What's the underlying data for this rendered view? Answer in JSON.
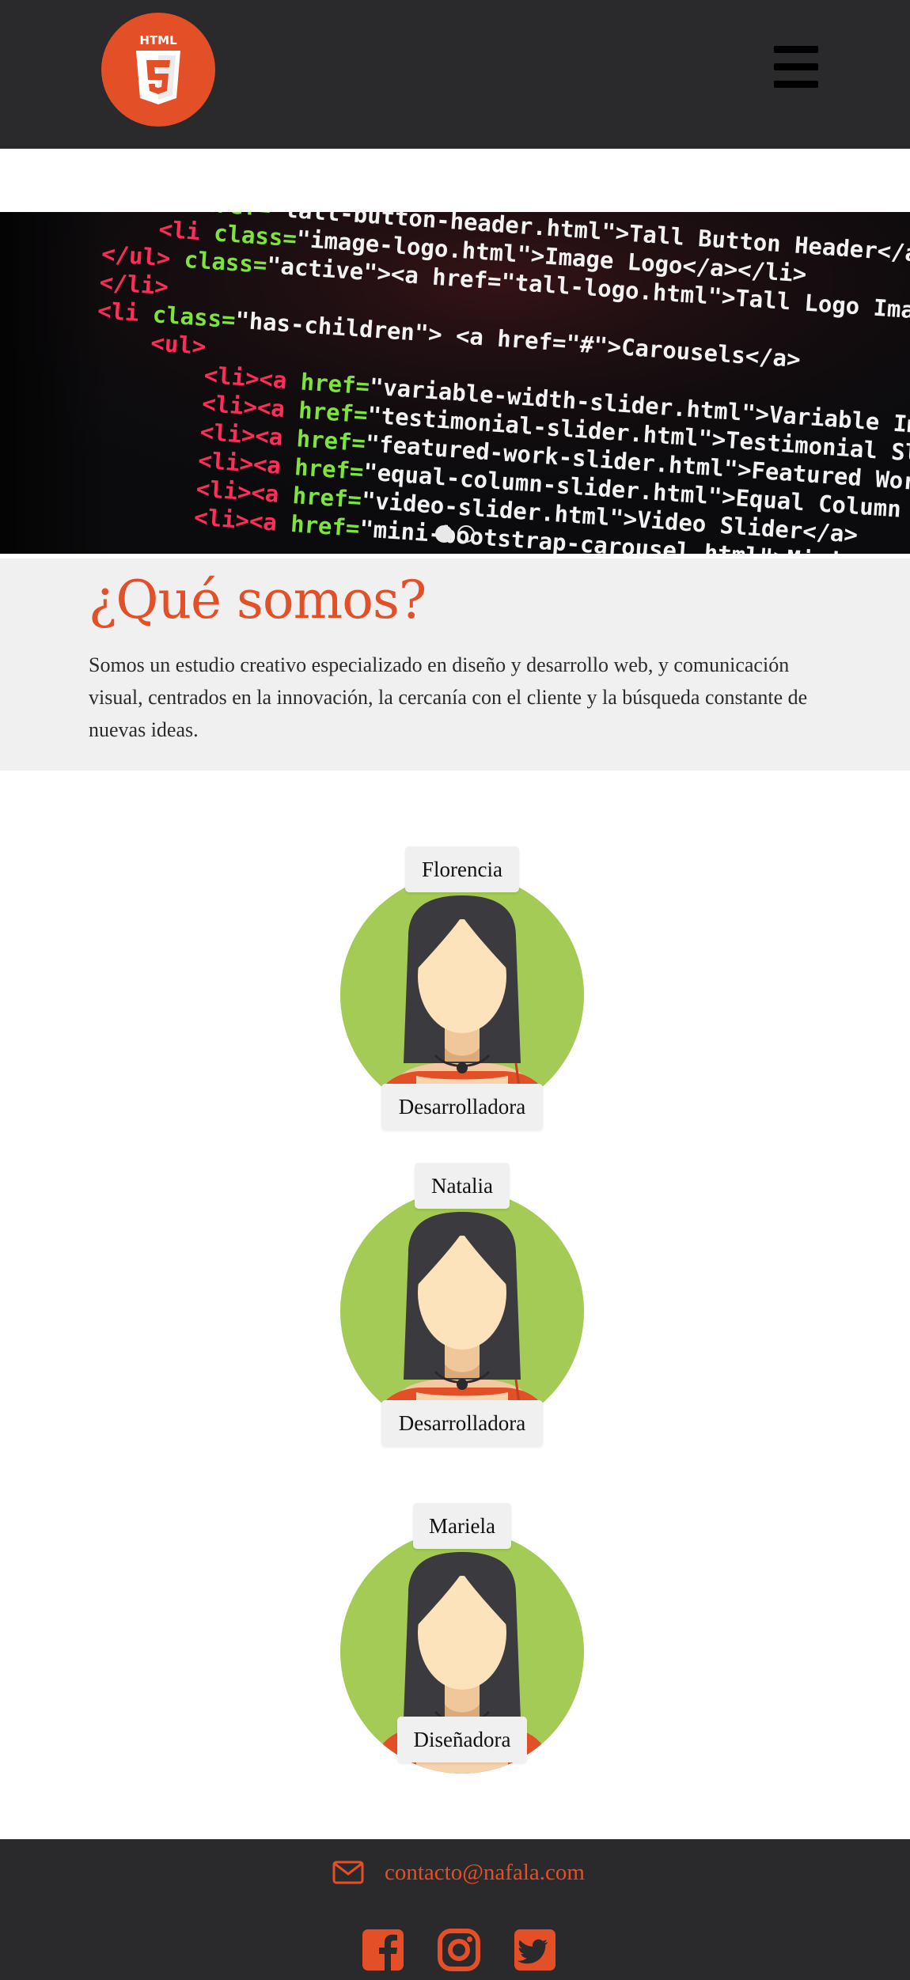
{
  "header": {
    "logo": {
      "icon": "html5-logo-icon",
      "text": "HTML",
      "badge": "5",
      "color": "#e34f26"
    },
    "menu": {
      "icon": "hamburger-menu-icon"
    }
  },
  "carousel": {
    "slide_count": 2,
    "active_index": 0,
    "code_lines": [
      {
        "indent": 0,
        "tag": "<li><a ",
        "attr": "href=",
        "value": "\"tall-button-header.html\">",
        "text": "Tall Button Header</a></li>"
      },
      {
        "indent": 1,
        "tag": "<li ",
        "attr": "class=",
        "value": "\"image-logo.html\">",
        "text": "Image Logo</a></li>"
      },
      {
        "indent": 0,
        "tag": "</ul> ",
        "attr": "class=",
        "value": "\"active\"><a href=\"tall-logo.html\">",
        "text": "Tall Logo Image</a></li>"
      },
      {
        "indent": 0,
        "tag": "</li>",
        "attr": "",
        "value": "",
        "text": ""
      },
      {
        "indent": 0,
        "tag": "<li ",
        "attr": "class=",
        "value": "\"has-children\"> <a href=\"#\">",
        "text": "Carousels</a>"
      },
      {
        "indent": 1,
        "tag": "<ul>",
        "attr": "",
        "value": "",
        "text": ""
      },
      {
        "indent": 2,
        "tag": "<li><a ",
        "attr": "href=",
        "value": "\"variable-width-slider.html\">",
        "text": "Variable Image Wi"
      },
      {
        "indent": 2,
        "tag": "<li><a ",
        "attr": "href=",
        "value": "\"testimonial-slider.html\">",
        "text": "Testimonial Slider</a>"
      },
      {
        "indent": 2,
        "tag": "<li><a ",
        "attr": "href=",
        "value": "\"featured-work-slider.html\">",
        "text": "Featured Work Sli"
      },
      {
        "indent": 2,
        "tag": "<li><a ",
        "attr": "href=",
        "value": "\"equal-column-slider.html\">",
        "text": "Equal Column Sli"
      },
      {
        "indent": 2,
        "tag": "<li><a ",
        "attr": "href=",
        "value": "\"video-slider.html\">",
        "text": "Video Slider</a>"
      },
      {
        "indent": 2,
        "tag": "<li><a ",
        "attr": "href=",
        "value": "\"mini-bootstrap-carousel.html\">",
        "text": "Mini Slider"
      }
    ]
  },
  "about": {
    "title": "¿Qué somos?",
    "description": "Somos un estudio creativo especializado en diseño y desarrollo web, y comunicación visual, centrados en la innovación, la cercanía con el cliente y la búsqueda constante de nuevas ideas."
  },
  "team": [
    {
      "name": "Florencia",
      "role": "Desarrolladora"
    },
    {
      "name": "Natalia",
      "role": "Desarrolladora"
    },
    {
      "name": "Mariela",
      "role": "Diseñadora"
    }
  ],
  "footer": {
    "email_icon": "envelope-icon",
    "email": "contacto@nafala.com",
    "social": [
      {
        "icon": "facebook-icon"
      },
      {
        "icon": "instagram-icon"
      },
      {
        "icon": "twitter-icon"
      }
    ]
  },
  "colors": {
    "accent": "#e34f26",
    "header_bg": "#2a2a2c",
    "section_bg": "#f0f0f0",
    "avatar_bg": "#a3cb55"
  }
}
